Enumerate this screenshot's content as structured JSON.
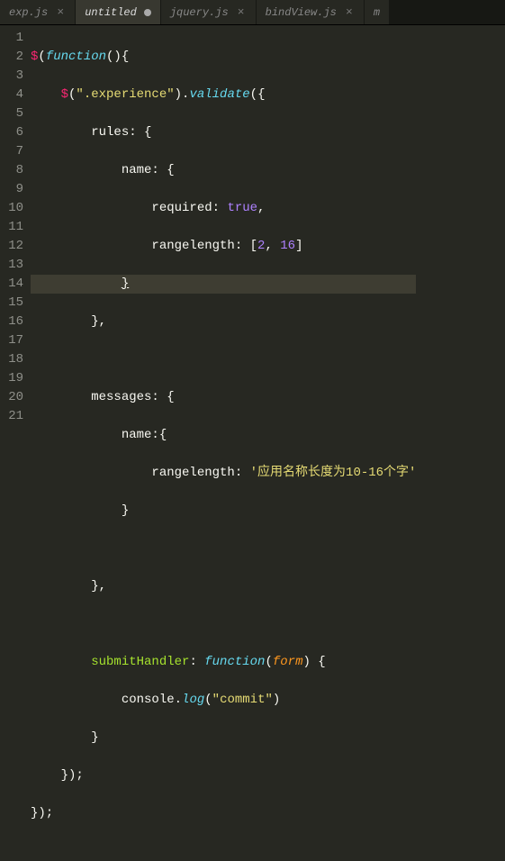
{
  "tabs": [
    {
      "label": "exp.js",
      "active": false,
      "dirty": false
    },
    {
      "label": "untitled",
      "active": true,
      "dirty": true
    },
    {
      "label": "jquery.js",
      "active": false,
      "dirty": false
    },
    {
      "label": "bindView.js",
      "active": false,
      "dirty": false
    },
    {
      "label": "m",
      "active": false,
      "dirty": false
    }
  ],
  "icons": {
    "close": "×"
  },
  "lineNumbers": [
    "1",
    "2",
    "3",
    "4",
    "5",
    "6",
    "7",
    "8",
    "9",
    "10",
    "11",
    "12",
    "13",
    "14",
    "15",
    "16",
    "17",
    "18",
    "19",
    "20",
    "21"
  ],
  "highlightLine": 7,
  "code": {
    "l1": {
      "t1": "$",
      "t2": "(",
      "t3": "function",
      "t4": "(){"
    },
    "l2": {
      "indent": "    ",
      "t1": "$",
      "t2": "(",
      "t3": "\".experience\"",
      "t4": ").",
      "t5": "validate",
      "t6": "({"
    },
    "l3": {
      "indent": "        ",
      "t1": "rules: {"
    },
    "l4": {
      "indent": "            ",
      "t1": "name: {"
    },
    "l5": {
      "indent": "                ",
      "t1": "required: ",
      "t2": "true",
      "t3": ","
    },
    "l6": {
      "indent": "                ",
      "t1": "rangelength: [",
      "t2": "2",
      "t3": ", ",
      "t4": "16",
      "t5": "]"
    },
    "l7": {
      "indent": "            ",
      "t1": "}"
    },
    "l8": {
      "indent": "        ",
      "t1": "},"
    },
    "l9": {
      "indent": ""
    },
    "l10": {
      "indent": "        ",
      "t1": "messages: {"
    },
    "l11": {
      "indent": "            ",
      "t1": "name:{"
    },
    "l12": {
      "indent": "                ",
      "t1": "rangelength: ",
      "t2": "'应用名称长度为10-16个字'"
    },
    "l13": {
      "indent": "            ",
      "t1": "}"
    },
    "l14": {
      "indent": ""
    },
    "l15": {
      "indent": "        ",
      "t1": "},"
    },
    "l16": {
      "indent": ""
    },
    "l17": {
      "indent": "        ",
      "t1": "submitHandler",
      "t2": ": ",
      "t3": "function",
      "t4": "(",
      "t5": "form",
      "t6": ") {"
    },
    "l18": {
      "indent": "            ",
      "t1": "console.",
      "t2": "log",
      "t3": "(",
      "t4": "\"commit\"",
      "t5": ")"
    },
    "l19": {
      "indent": "        ",
      "t1": "}"
    },
    "l20": {
      "indent": "    ",
      "t1": "});"
    },
    "l21": {
      "t1": "});"
    }
  }
}
